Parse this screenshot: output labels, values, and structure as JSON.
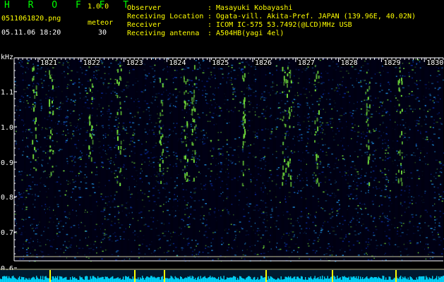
{
  "header": {
    "app_title": "H R O F F T",
    "app_version": "1.0.0",
    "filename": "0511061820.png",
    "timestamp": "05.11.06 18:20",
    "meteor_label": "meteor",
    "meteor_count": "30",
    "fields": [
      {
        "label": "Observer",
        "value": ": Masayuki Kobayashi"
      },
      {
        "label": "Receiving Location",
        "value": ": Ogata-vill. Akita-Pref. JAPAN (139.96E, 40.02N)"
      },
      {
        "label": "Receiver",
        "value": ": ICOM IC-575 53.7492(@LCD)MHz USB"
      },
      {
        "label": "Receiving antenna",
        "value": ": A504HB(yagi 4el)"
      }
    ]
  },
  "spectrogram": {
    "y_unit": "kHz",
    "y_ticks": [
      "1.1",
      "1.0",
      "0.9",
      "0.8",
      "0.7",
      "0.6"
    ],
    "time_ticks": [
      "1821",
      "1822",
      "1823",
      "1824",
      "1825",
      "1826",
      "1827",
      "1828",
      "1829",
      "1830"
    ],
    "colors": {
      "axis": "#ffffff",
      "background": "#000014",
      "low": "#0a2a9a",
      "mid": "#1e8ad6",
      "high": "#6fdc3a",
      "peak": "#ffff00",
      "baseline": "#00d8ff"
    }
  }
}
